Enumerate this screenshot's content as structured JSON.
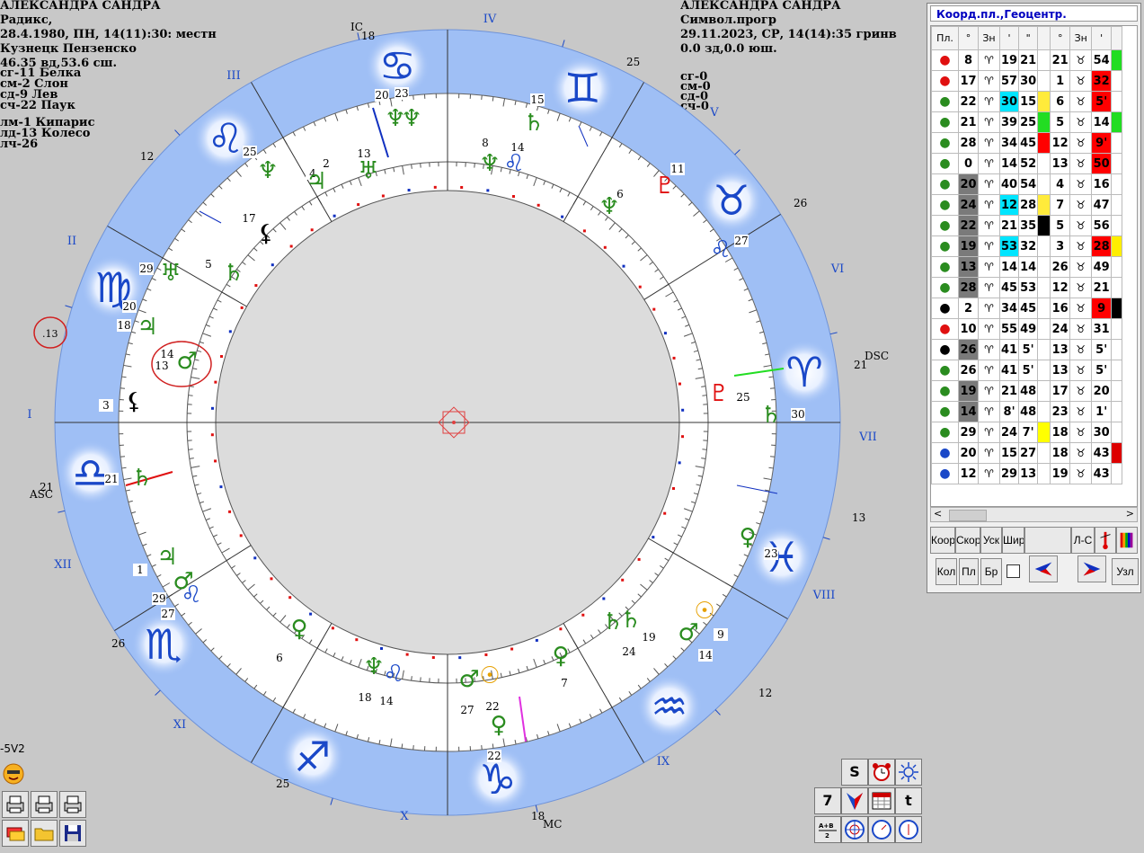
{
  "natal": {
    "name": "АЛЕКСАНДРА САНДРА",
    "chart_type": "Радикс,",
    "datetime": "28.4.1980, ПН, 14(11):30: местн",
    "place": "Кузнецк Пензенско",
    "coords": "46.35 вд,53.6 сш.",
    "params": [
      "сг-11 Белка",
      "см-2 Слон",
      "сд-9 Лев",
      "сч-22 Паук",
      "лм-1 Кипарис",
      "лд-13 Колесо",
      "лч-26"
    ]
  },
  "progressed": {
    "name": "АЛЕКСАНДРА САНДРА",
    "chart_type": "Символ.прогр",
    "datetime": "29.11.2023, СР, 14(14):35 гринв",
    "coords": "0.0 зд,0.0 юш.",
    "params": [
      "сг-0",
      "см-0",
      "сд-0",
      "сч-0"
    ]
  },
  "chart_labels": {
    "houses": [
      "I",
      "II",
      "III",
      "IV",
      "V",
      "VI",
      "VII",
      "VIII",
      "IX",
      "X",
      "XI",
      "XII"
    ],
    "ic": "IC",
    "dsc": "DSC",
    "asc": "ASC",
    "mc": "MC",
    "ic_deg": "18",
    "dsc_deg": "21",
    "asc_deg": "21",
    "mc_deg": "18",
    "outer_degrees": [
      "25",
      "26",
      "13",
      "12",
      "25",
      "26",
      "12",
      "13"
    ],
    "inner_degrees": [
      "20",
      "23",
      "13",
      "8",
      "14",
      "15",
      "11",
      "6",
      "27",
      "25",
      "30",
      "23",
      "9",
      "14",
      "7",
      "24",
      "19",
      "22",
      "27",
      "22",
      "14",
      "18",
      "6",
      "27",
      "29",
      "1",
      "21",
      "3",
      "13",
      "14",
      "18",
      "20",
      "29",
      "5",
      "17",
      "25",
      "4",
      "2"
    ],
    "circled_degree": ".13"
  },
  "colors": {
    "blue_ring": "#9fbff5",
    "sign_glyph": "#1a48c8",
    "planet_green": "#2a8c1f",
    "planet_red": "#e01010",
    "accent_magenta": "#e030e0",
    "highlight_red": "#d02020"
  },
  "panel": {
    "title": "Коорд.пл.,Геоцентр.",
    "headers": [
      "Пл.",
      "°",
      "Зн",
      "'",
      "\"",
      "°",
      "Зн",
      "'"
    ],
    "rows": [
      [
        "8",
        "19",
        "21",
        "21",
        "54"
      ],
      [
        "17",
        "57",
        "30",
        "1",
        "32"
      ],
      [
        "22",
        "30",
        "15",
        "6",
        "5'"
      ],
      [
        "21",
        "39",
        "25",
        "5",
        "14"
      ],
      [
        "28",
        "34",
        "45",
        "12",
        "9'"
      ],
      [
        "0",
        "14",
        "52",
        "13",
        "50"
      ],
      [
        "20",
        "40",
        "54",
        "4",
        "16"
      ],
      [
        "24",
        "12",
        "28",
        "7",
        "47"
      ],
      [
        "22",
        "21",
        "35",
        "5",
        "56"
      ],
      [
        "19",
        "53",
        "32",
        "3",
        "28"
      ],
      [
        "13",
        "14",
        "14",
        "26",
        "49"
      ],
      [
        "28",
        "45",
        "53",
        "12",
        "21"
      ],
      [
        "2",
        "34",
        "45",
        "16",
        "9"
      ],
      [
        "10",
        "55",
        "49",
        "24",
        "31"
      ],
      [
        "26",
        "41",
        "5'",
        "13",
        "5'"
      ],
      [
        "26",
        "41",
        "5'",
        "13",
        "5'"
      ],
      [
        "19",
        "21",
        "48",
        "17",
        "20"
      ],
      [
        "14",
        "8'",
        "48",
        "23",
        "1'"
      ],
      [
        "29",
        "24",
        "7'",
        "18",
        "30"
      ],
      [
        "20",
        "15",
        "27",
        "18",
        "43"
      ],
      [
        "12",
        "29",
        "13",
        "19",
        "43"
      ]
    ],
    "buttons_row1": [
      "Коор",
      "Скор",
      "Уск",
      "Шир",
      "Л-С"
    ],
    "buttons_row2": [
      "Кол",
      "Пл",
      "Бр",
      "Узл"
    ]
  },
  "left_toolbar": {
    "label": "-5V2"
  },
  "right_toolbar": {
    "s_label": "S",
    "seven_label": "7",
    "t_label": "t"
  }
}
